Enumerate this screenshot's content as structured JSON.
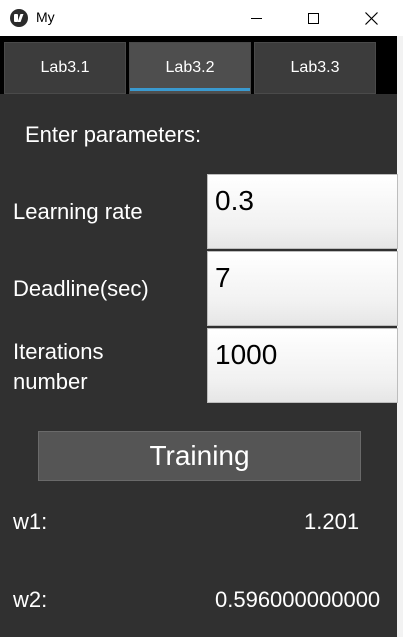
{
  "window": {
    "title": "My",
    "icons": {
      "app": "kivy-logo-icon",
      "minimize": "minimize-icon",
      "maximize": "maximize-icon",
      "close": "close-icon"
    }
  },
  "tabs": [
    {
      "label": "Lab3.1",
      "active": false
    },
    {
      "label": "Lab3.2",
      "active": true
    },
    {
      "label": "Lab3.3",
      "active": false
    }
  ],
  "form": {
    "heading": "Enter parameters:",
    "learning_rate": {
      "label": "Learning rate",
      "value": "0.3"
    },
    "deadline": {
      "label": "Deadline(sec)",
      "value": "7"
    },
    "iterations": {
      "label_line1": "Iterations",
      "label_line2": "number",
      "value": "1000"
    },
    "train_label": "Training"
  },
  "results": {
    "w1": {
      "label": "w1:",
      "value": "1.201"
    },
    "w2": {
      "label": "w2:",
      "value": "0.596000000000"
    }
  },
  "colors": {
    "background": "#303030",
    "tab_accent": "#3a9ad0",
    "button": "#555555",
    "input_bg": "#ffffff"
  }
}
